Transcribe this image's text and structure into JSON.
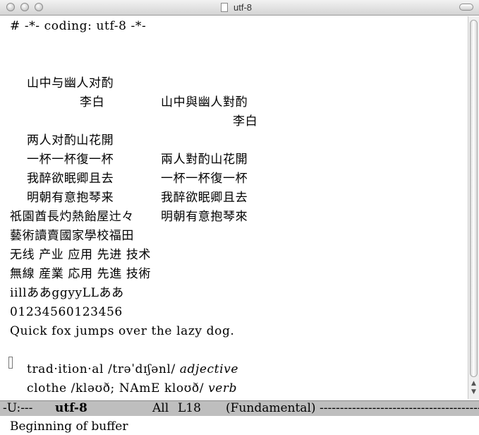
{
  "window": {
    "title": "utf-8"
  },
  "buffer": {
    "line1": "# -*- coding: utf-8 -*-",
    "poem_title_simplified": "山中与幽人对酌",
    "poem_title_traditional": "山中與幽人對酌",
    "author_simplified": "李白",
    "author_traditional": "李白",
    "verse1_simplified": "两人对酌山花開",
    "verse1_traditional": "兩人對酌山花開",
    "verse2_simplified": "一杯一杯復一杯",
    "verse2_traditional": "一杯一杯復一杯",
    "verse3_simplified": "我醉欲眠卿且去",
    "verse3_traditional": "我醉欲眠卿且去",
    "verse4_simplified": "明朝有意抱琴来",
    "verse4_traditional": "明朝有意抱琴來",
    "kanji1": "祇園酋長灼熱飴屋辻々",
    "kanji2": "藝術讀賣國家學校福田",
    "tech_simplified": "无线 产业 应用 先进 技术",
    "tech_japanese": "無線 産業 応用 先進 技術",
    "mixed_glyphs": "iillああggyyLLああ",
    "digits": "01234560123456",
    "pangram": "Quick fox jumps over the lazy dog.",
    "dict1_head": "trad·ition·al /trəˈdɪʃənl/ ",
    "dict1_pos": "adjective",
    "dict2_head": "clothe /kləʊð; NAmE kloʊð/ ",
    "dict2_pos": "verb"
  },
  "modeline": {
    "status": "-U:---",
    "buffer_name": "utf-8",
    "position": "All",
    "line": "L18",
    "mode": "(Fundamental)",
    "fill": "-----------------------------------------"
  },
  "minibuffer": {
    "message": "Beginning of buffer"
  }
}
